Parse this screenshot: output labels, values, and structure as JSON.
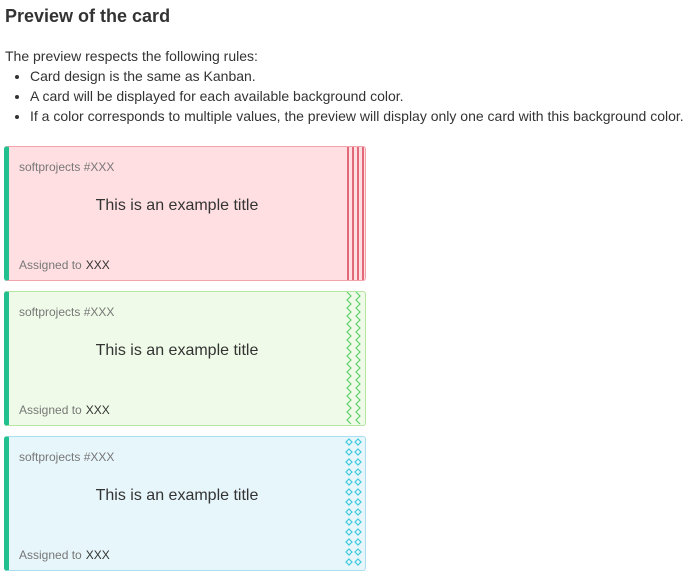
{
  "page": {
    "title": "Preview of the card",
    "intro": "The preview respects the following rules:",
    "rules": [
      "Card design is the same as Kanban.",
      "A card will be displayed for each available background color.",
      "If a color corresponds to multiple values, the preview will display only one card with this background color."
    ]
  },
  "cards": [
    {
      "reference": "softprojects #XXX",
      "title": "This is an example title",
      "assigned_label": "Assigned to",
      "assigned_value": "XXX",
      "background": "#ffdfe1",
      "border": "#f2a3ab",
      "accent": "#22c08e",
      "pattern_color": "#e2697a",
      "pattern": "stripes-icon"
    },
    {
      "reference": "softprojects #XXX",
      "title": "This is an example title",
      "assigned_label": "Assigned to",
      "assigned_value": "XXX",
      "background": "#effbe8",
      "border": "#b5e6a2",
      "accent": "#22c08e",
      "pattern_color": "#5fd06c",
      "pattern": "zigzag-icon"
    },
    {
      "reference": "softprojects #XXX",
      "title": "This is an example title",
      "assigned_label": "Assigned to",
      "assigned_value": "XXX",
      "background": "#e7f6fb",
      "border": "#a8dff0",
      "accent": "#22c08e",
      "pattern_color": "#3ec9dc",
      "pattern": "diamonds-icon"
    }
  ]
}
